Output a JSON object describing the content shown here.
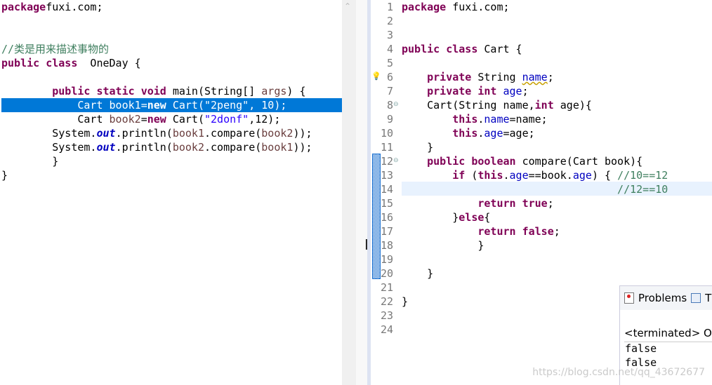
{
  "left_editor": {
    "selected_line": 8,
    "lines": [
      [
        [
          "k",
          "package"
        ],
        [
          "",
          "fuxi.com;"
        ]
      ],
      [],
      [],
      [
        [
          "c",
          "//类是用来描述事物的"
        ]
      ],
      [
        [
          "k",
          "public"
        ],
        [
          "",
          " "
        ],
        [
          "k",
          "class"
        ],
        [
          "",
          "  OneDay {"
        ]
      ],
      [],
      [
        [
          "",
          "        "
        ],
        [
          "k",
          "public"
        ],
        [
          "",
          " "
        ],
        [
          "k",
          "static"
        ],
        [
          "",
          " "
        ],
        [
          "k",
          "void"
        ],
        [
          "",
          " main(String[] "
        ],
        [
          "v",
          "args"
        ],
        [
          "",
          ") {"
        ]
      ],
      [
        [
          "",
          "            Cart "
        ],
        [
          "v",
          "book1"
        ],
        [
          "",
          "="
        ],
        [
          "k",
          "new"
        ],
        [
          "",
          " Cart("
        ],
        [
          "s",
          "\"2peng\""
        ],
        [
          "",
          ", 10);"
        ]
      ],
      [
        [
          "",
          "            Cart "
        ],
        [
          "v",
          "book2"
        ],
        [
          "",
          "="
        ],
        [
          "k",
          "new"
        ],
        [
          "",
          " Cart("
        ],
        [
          "s",
          "\"2donf\""
        ],
        [
          "",
          ",12);"
        ]
      ],
      [
        [
          "",
          "        System."
        ],
        [
          "sf",
          "out"
        ],
        [
          "",
          ".println("
        ],
        [
          "v",
          "book1"
        ],
        [
          "",
          ".compare("
        ],
        [
          "v",
          "book2"
        ],
        [
          "",
          "));"
        ]
      ],
      [
        [
          "",
          "        System."
        ],
        [
          "sf",
          "out"
        ],
        [
          "",
          ".println("
        ],
        [
          "v",
          "book2"
        ],
        [
          "",
          ".compare("
        ],
        [
          "v",
          "book1"
        ],
        [
          "",
          "));"
        ]
      ],
      [
        [
          "",
          "        }"
        ]
      ],
      [
        [
          "",
          "}"
        ]
      ]
    ]
  },
  "right_editor": {
    "line_numbers": [
      "1",
      "2",
      "3",
      "4",
      "5",
      "6",
      "7",
      "8",
      "9",
      "10",
      "11",
      "12",
      "13",
      "14",
      "15",
      "16",
      "17",
      "18",
      "19",
      "20",
      "21",
      "22",
      "23",
      "24"
    ],
    "current_line": 14,
    "lines": [
      [
        [
          "k",
          "package"
        ],
        [
          "",
          " fuxi.com;"
        ]
      ],
      [],
      [],
      [
        [
          "k",
          "public"
        ],
        [
          "",
          " "
        ],
        [
          "k",
          "class"
        ],
        [
          "",
          " Cart {"
        ]
      ],
      [],
      [
        [
          "",
          "    "
        ],
        [
          "k",
          "private"
        ],
        [
          "",
          " String "
        ],
        [
          "fw",
          "name"
        ],
        [
          "",
          ";"
        ]
      ],
      [
        [
          "",
          "    "
        ],
        [
          "k",
          "private"
        ],
        [
          "",
          " "
        ],
        [
          "k",
          "int"
        ],
        [
          "",
          " "
        ],
        [
          "f",
          "age"
        ],
        [
          "",
          ";"
        ]
      ],
      [
        [
          "",
          "    Cart(String name,"
        ],
        [
          "k",
          "int"
        ],
        [
          "",
          " age){"
        ]
      ],
      [
        [
          "",
          "        "
        ],
        [
          "k",
          "this"
        ],
        [
          "",
          "."
        ],
        [
          "f",
          "name"
        ],
        [
          "",
          "=name;"
        ]
      ],
      [
        [
          "",
          "        "
        ],
        [
          "k",
          "this"
        ],
        [
          "",
          "."
        ],
        [
          "f",
          "age"
        ],
        [
          "",
          "=age;"
        ]
      ],
      [
        [
          "",
          "    }"
        ]
      ],
      [
        [
          "",
          "    "
        ],
        [
          "k",
          "public"
        ],
        [
          "",
          " "
        ],
        [
          "k",
          "boolean"
        ],
        [
          "",
          " compare(Cart book){"
        ]
      ],
      [
        [
          "",
          "        "
        ],
        [
          "k",
          "if"
        ],
        [
          "",
          " ("
        ],
        [
          "k",
          "this"
        ],
        [
          "",
          "."
        ],
        [
          "f",
          "age"
        ],
        [
          "",
          "==book."
        ],
        [
          "f",
          "age"
        ],
        [
          "",
          ") { "
        ],
        [
          "c",
          "//10==12"
        ]
      ],
      [
        [
          "",
          "                                  "
        ],
        [
          "c",
          "//12==10"
        ]
      ],
      [
        [
          "",
          "            "
        ],
        [
          "k",
          "return"
        ],
        [
          "",
          " "
        ],
        [
          "k",
          "true"
        ],
        [
          "",
          ";"
        ]
      ],
      [
        [
          "",
          "        }"
        ],
        [
          "k",
          "else"
        ],
        [
          "",
          "{"
        ]
      ],
      [
        [
          "",
          "            "
        ],
        [
          "k",
          "return"
        ],
        [
          "",
          " "
        ],
        [
          "k",
          "false"
        ],
        [
          "",
          ";"
        ]
      ],
      [
        [
          "",
          "            }"
        ]
      ],
      [],
      [
        [
          "",
          "    }"
        ]
      ],
      [],
      [
        [
          "",
          "}"
        ]
      ],
      [],
      []
    ]
  },
  "console": {
    "tab_problems": "Problems",
    "tab_next": "T",
    "status": "<terminated> On",
    "output": [
      "false",
      "false"
    ]
  },
  "watermark": "https://blog.csdn.net/qq_43672677",
  "icons": {
    "warning_marker": "lightbulb-warning-icon",
    "fold": "fold-minus-icon",
    "scroll_up": "chevron-up-icon"
  }
}
